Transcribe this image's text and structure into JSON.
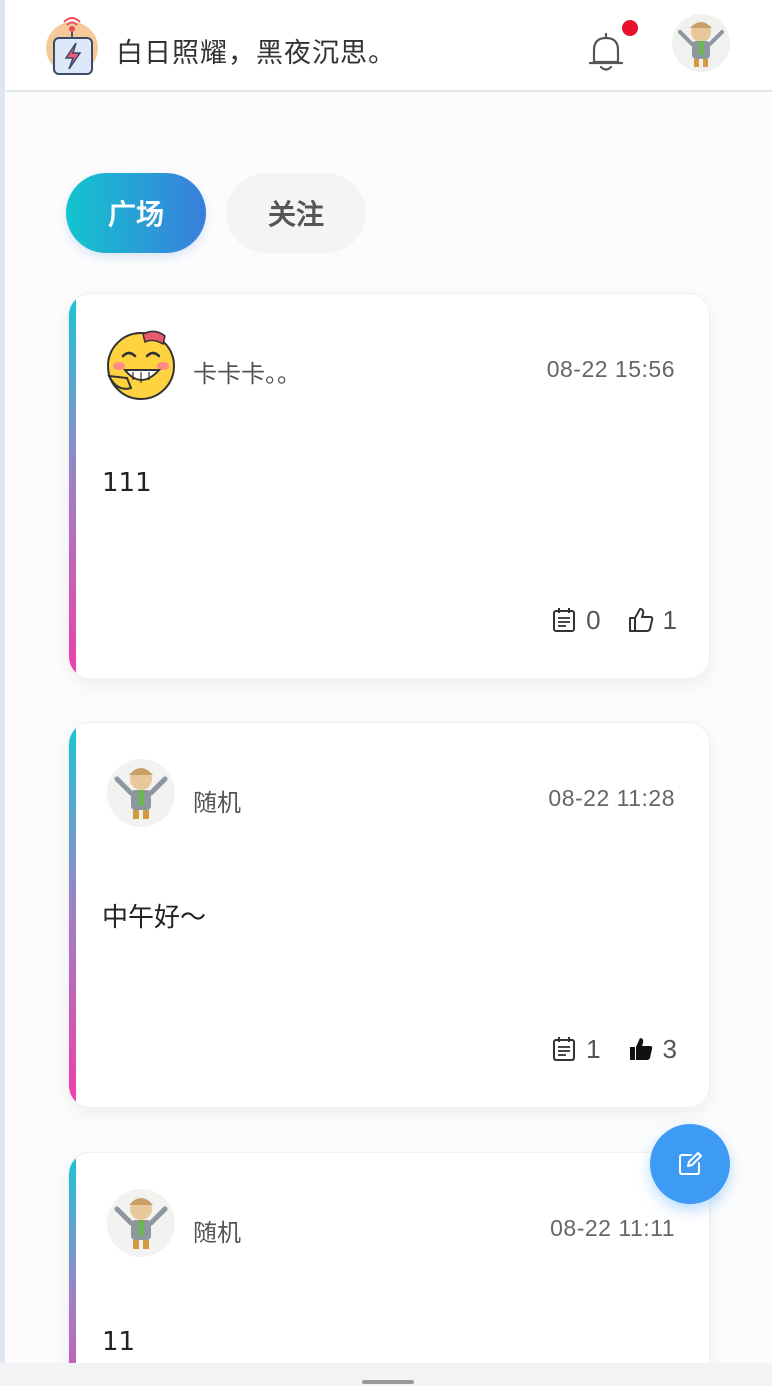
{
  "header": {
    "slogan": "白日照耀，黑夜沉思。",
    "logo_icon": "lightning-badge-icon",
    "bell_icon": "bell-icon",
    "has_notification": true,
    "colors": {
      "notification_dot": "#e8102d"
    }
  },
  "tabs": [
    {
      "label": "广场",
      "active": true
    },
    {
      "label": "关注",
      "active": false
    }
  ],
  "posts": [
    {
      "author": "卡卡卡。。",
      "time": "08-22 15:56",
      "content": "111",
      "comments": "0",
      "likes": "1",
      "liked": false,
      "avatar_icon": "laughing-emoji-icon"
    },
    {
      "author": "随机",
      "time": "08-22 11:28",
      "content": "中午好～",
      "comments": "1",
      "likes": "3",
      "liked": true,
      "avatar_icon": "cartoon-kid-avatar-icon"
    },
    {
      "author": "随机",
      "time": "08-22 11:11",
      "content": "11",
      "comments": "",
      "likes": "",
      "liked": false,
      "avatar_icon": "cartoon-kid-avatar-icon"
    }
  ],
  "fab": {
    "icon": "edit-icon",
    "color": "#3d9bf5"
  },
  "colors": {
    "tab_active_start": "#13c5cf",
    "tab_active_end": "#3a7ddc",
    "card_accent_top": "#17c6d4",
    "card_accent_bottom": "#f03da9"
  }
}
